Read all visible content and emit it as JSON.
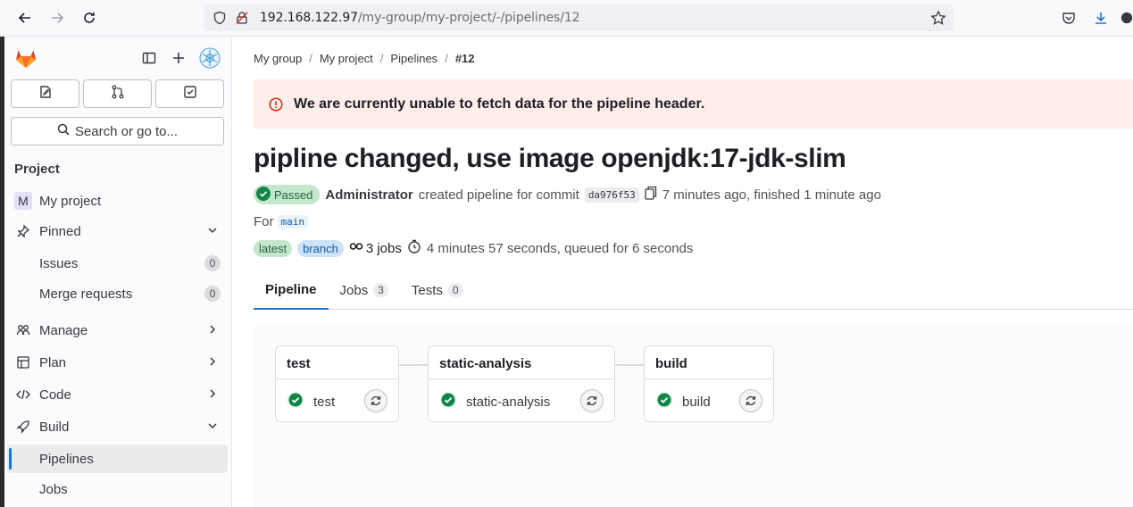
{
  "browser": {
    "url_host": "192.168.122.97",
    "url_path": "/my-group/my-project/-/pipelines/12"
  },
  "sidebar": {
    "search_label": "Search or go to...",
    "section_title": "Project",
    "project_initial": "M",
    "project_name": "My project",
    "pinned": "Pinned",
    "issues": {
      "label": "Issues",
      "count": "0"
    },
    "merge_requests": {
      "label": "Merge requests",
      "count": "0"
    },
    "manage": "Manage",
    "plan": "Plan",
    "code": "Code",
    "build": "Build",
    "pipelines": "Pipelines",
    "jobs": "Jobs"
  },
  "breadcrumb": {
    "group": "My group",
    "project": "My project",
    "pipelines": "Pipelines",
    "current": "#12"
  },
  "alert": {
    "message": "We are currently unable to fetch data for the pipeline header."
  },
  "pipeline": {
    "title": "pipline changed, use image openjdk:17-jdk-slim",
    "status": "Passed",
    "author": "Administrator",
    "action": "created pipeline for commit",
    "sha": "da976f53",
    "timing": "7 minutes ago, finished 1 minute ago",
    "for_label": "For",
    "ref": "main",
    "tag_latest": "latest",
    "tag_branch": "branch",
    "jobs_summary": "3 jobs",
    "duration": "4 minutes 57 seconds, queued for 6 seconds"
  },
  "tabs": [
    {
      "label": "Pipeline",
      "count": ""
    },
    {
      "label": "Jobs",
      "count": "3"
    },
    {
      "label": "Tests",
      "count": "0"
    }
  ],
  "stages": [
    {
      "name": "test",
      "job": "test"
    },
    {
      "name": "static-analysis",
      "job": "static-analysis"
    },
    {
      "name": "build",
      "job": "build"
    }
  ],
  "colors": {
    "accent": "#1f75cb",
    "success": "#108548",
    "alert_bg": "#fdeeea",
    "danger": "#dd2b0e"
  }
}
